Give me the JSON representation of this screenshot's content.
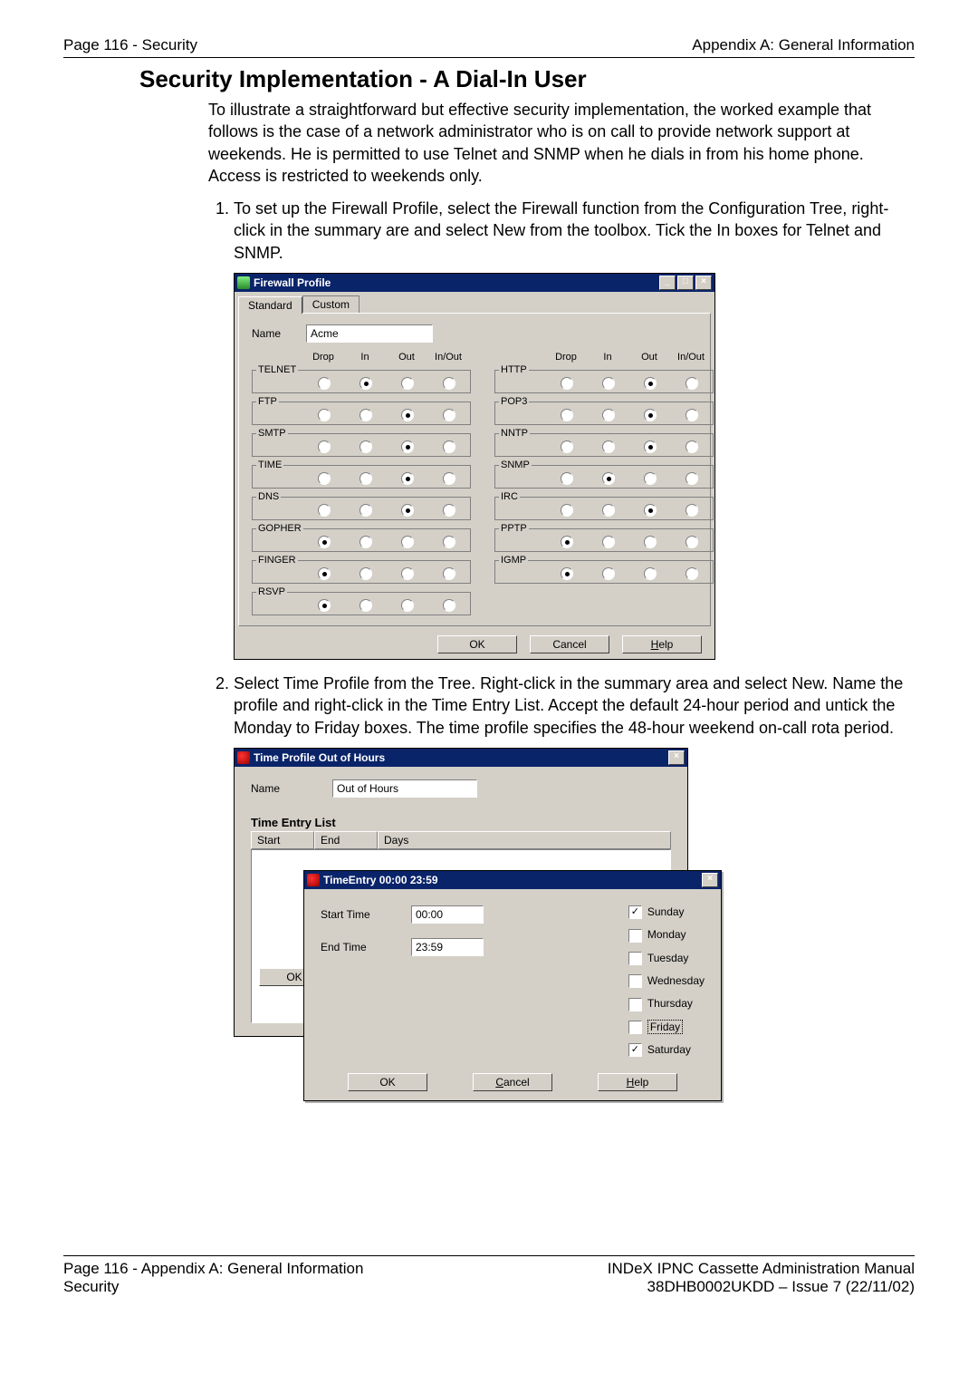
{
  "header": {
    "left": "Page 116 - Security",
    "right": "Appendix A: General Information"
  },
  "section_title": "Security Implementation - A Dial-In User",
  "intro": "To illustrate a straightforward but effective security implementation, the worked example that follows is the case of a network administrator who is on call to provide network support at weekends. He is permitted to use Telnet and SNMP when he dials in from his home phone. Access is restricted to weekends only.",
  "steps": [
    "To set up the Firewall Profile, select the Firewall function from the Configuration Tree, right-click in the summary are and select New from the toolbox. Tick the In boxes for Telnet and SNMP.",
    "Select Time Profile from the Tree. Right-click in the summary area and select New. Name the profile and right-click in the Time Entry List. Accept the default 24-hour period and untick the Monday to Friday boxes. The time profile specifies the 48-hour weekend on-call rota period."
  ],
  "firewall_window": {
    "title": "Firewall Profile",
    "tabs": [
      "Standard",
      "Custom"
    ],
    "name_label": "Name",
    "name_value": "Acme",
    "column_headers": [
      "Drop",
      "In",
      "Out",
      "In/Out"
    ],
    "left_protocols": [
      {
        "name": "TELNET",
        "sel": 1
      },
      {
        "name": "FTP",
        "sel": 2
      },
      {
        "name": "SMTP",
        "sel": 2
      },
      {
        "name": "TIME",
        "sel": 2
      },
      {
        "name": "DNS",
        "sel": 2
      },
      {
        "name": "GOPHER",
        "sel": 0
      },
      {
        "name": "FINGER",
        "sel": 0
      },
      {
        "name": "RSVP",
        "sel": 0
      }
    ],
    "right_protocols": [
      {
        "name": "HTTP",
        "sel": 2
      },
      {
        "name": "POP3",
        "sel": 2
      },
      {
        "name": "NNTP",
        "sel": 2
      },
      {
        "name": "SNMP",
        "sel": 1
      },
      {
        "name": "IRC",
        "sel": 2
      },
      {
        "name": "PPTP",
        "sel": 0
      },
      {
        "name": "IGMP",
        "sel": 0
      }
    ],
    "buttons": {
      "ok": "OK",
      "cancel": "Cancel",
      "help": "Help"
    }
  },
  "timeprofile_window": {
    "title": "Time Profile Out of Hours",
    "name_label": "Name",
    "name_value": "Out of Hours",
    "list_heading": "Time Entry List",
    "cols": [
      "Start",
      "End",
      "Days"
    ],
    "ok": "OK"
  },
  "timeentry_window": {
    "title": "TimeEntry 00:00 23:59",
    "start_label": "Start Time",
    "start_value": "00:00",
    "end_label": "End Time",
    "end_value": "23:59",
    "days": [
      {
        "label": "Sunday",
        "checked": true
      },
      {
        "label": "Monday",
        "checked": false
      },
      {
        "label": "Tuesday",
        "checked": false
      },
      {
        "label": "Wednesday",
        "checked": false
      },
      {
        "label": "Thursday",
        "checked": false
      },
      {
        "label": "Friday",
        "checked": false,
        "focus": true
      },
      {
        "label": "Saturday",
        "checked": true
      }
    ],
    "buttons": {
      "ok": "OK",
      "cancel": "Cancel",
      "help": "Help"
    }
  },
  "footer": {
    "bl1": "Page 116 - Appendix A: General Information",
    "bl2": "Security",
    "br1": "INDeX IPNC Cassette Administration Manual",
    "br2": "38DHB0002UKDD – Issue 7 (22/11/02)"
  }
}
